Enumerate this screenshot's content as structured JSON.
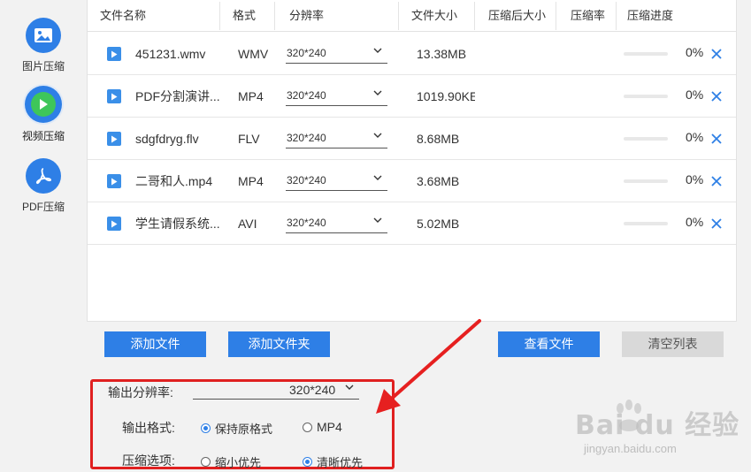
{
  "sidebar": {
    "items": [
      {
        "label": "图片压缩",
        "icon": "image-icon",
        "active": false
      },
      {
        "label": "视频压缩",
        "icon": "play-icon",
        "active": true
      },
      {
        "label": "PDF压缩",
        "icon": "pdf-icon",
        "active": false
      }
    ]
  },
  "table": {
    "columns": [
      "文件名称",
      "格式",
      "分辨率",
      "文件大小",
      "压缩后大小",
      "压缩率",
      "压缩进度"
    ],
    "rows": [
      {
        "name": "451231.wmv",
        "format": "WMV",
        "resolution": "320*240",
        "size": "13.38MB",
        "compressed_size": "",
        "ratio": "",
        "progress": 0,
        "progress_text": "0%"
      },
      {
        "name": "PDF分割演讲...",
        "format": "MP4",
        "resolution": "320*240",
        "size": "1019.90KE",
        "compressed_size": "",
        "ratio": "",
        "progress": 0,
        "progress_text": "0%"
      },
      {
        "name": "sdgfdryg.flv",
        "format": "FLV",
        "resolution": "320*240",
        "size": "8.68MB",
        "compressed_size": "",
        "ratio": "",
        "progress": 0,
        "progress_text": "0%"
      },
      {
        "name": "二哥和人.mp4",
        "format": "MP4",
        "resolution": "320*240",
        "size": "3.68MB",
        "compressed_size": "",
        "ratio": "",
        "progress": 0,
        "progress_text": "0%"
      },
      {
        "name": "学生请假系统...",
        "format": "AVI",
        "resolution": "320*240",
        "size": "5.02MB",
        "compressed_size": "",
        "ratio": "",
        "progress": 0,
        "progress_text": "0%"
      }
    ]
  },
  "buttons": {
    "add_file": "添加文件",
    "add_folder": "添加文件夹",
    "view_files": "查看文件",
    "clear_list": "清空列表"
  },
  "options": {
    "resolution_label": "输出分辨率:",
    "resolution_value": "320*240",
    "format_label": "输出格式:",
    "format_options": [
      {
        "label": "保持原格式",
        "selected": true
      },
      {
        "label": "MP4",
        "selected": false
      }
    ],
    "compress_label": "压缩选项:",
    "compress_options": [
      {
        "label": "缩小优先",
        "selected": false
      },
      {
        "label": "清晰优先",
        "selected": true
      }
    ]
  },
  "watermark": {
    "main": "Bai du 经验",
    "sub": "jingyan.baidu.com"
  },
  "colors": {
    "accent": "#2e7fe6",
    "highlight": "#e02020",
    "disabled": "#d9d9d9"
  }
}
